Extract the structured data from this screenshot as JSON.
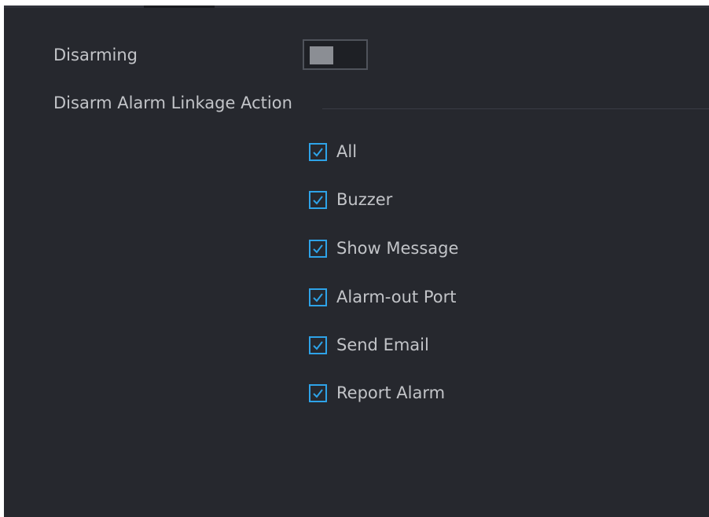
{
  "disarming": {
    "label": "Disarming",
    "enabled": false
  },
  "linkage": {
    "section_label": "Disarm Alarm Linkage Action",
    "items": [
      {
        "label": "All",
        "checked": true
      },
      {
        "label": "Buzzer",
        "checked": true
      },
      {
        "label": "Show Message",
        "checked": true
      },
      {
        "label": "Alarm-out Port",
        "checked": true
      },
      {
        "label": "Send Email",
        "checked": true
      },
      {
        "label": "Report Alarm",
        "checked": true
      }
    ]
  },
  "colors": {
    "background": "#26282e",
    "text": "#c2c4c8",
    "accent": "#2ea3e8",
    "toggle_knob": "#8b8e94"
  },
  "icons": {
    "checkbox": "checkmark-icon",
    "toggle": "toggle-switch-icon"
  }
}
